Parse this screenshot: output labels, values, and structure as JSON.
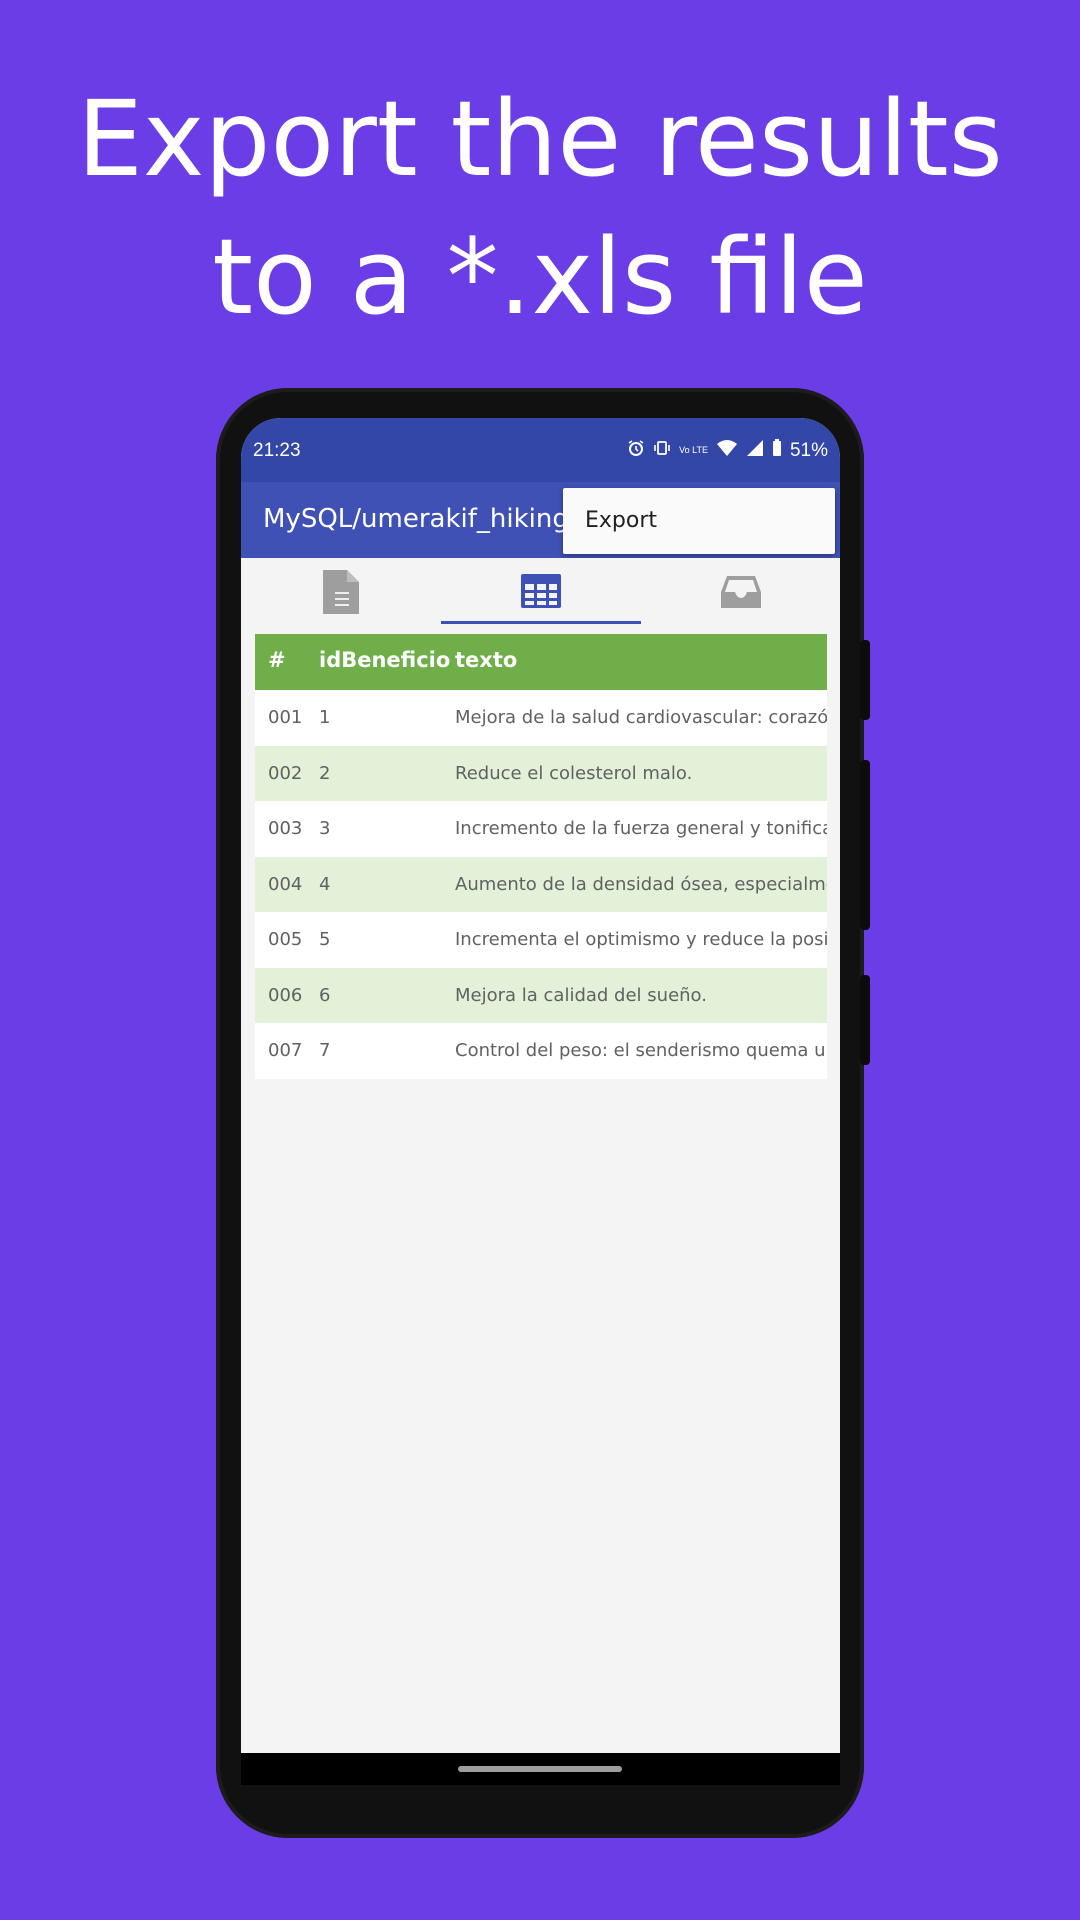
{
  "headline": {
    "line1": "Export the results",
    "line2": "to a *.xls file"
  },
  "status_bar": {
    "time": "21:23",
    "icons": [
      "alarm-icon",
      "vibrate-icon",
      "volte-icon",
      "wifi-icon",
      "signal-icon",
      "battery-icon"
    ],
    "lte_label": "Vo LTE",
    "battery": "51%"
  },
  "app_bar": {
    "title": "MySQL/umerakif_hiking"
  },
  "popup_menu": {
    "items": [
      "Export"
    ]
  },
  "tabs": [
    {
      "icon": "document-icon",
      "selected": false
    },
    {
      "icon": "table-icon",
      "selected": true
    },
    {
      "icon": "inbox-icon",
      "selected": false
    }
  ],
  "table": {
    "columns": [
      "#",
      "idBeneficio",
      "texto"
    ],
    "rows": [
      [
        "001",
        "1",
        "Mejora de la salud cardiovascular: corazón,"
      ],
      [
        "002",
        "2",
        "Reduce el colesterol malo."
      ],
      [
        "003",
        "3",
        "Incremento de la fuerza general y tonificac"
      ],
      [
        "004",
        "4",
        "Aumento de la densidad ósea, especialme"
      ],
      [
        "005",
        "5",
        "Incrementa el optimismo y reduce la posib"
      ],
      [
        "006",
        "6",
        "Mejora la calidad del sueño."
      ],
      [
        "007",
        "7",
        "Control del peso: el senderismo quema un"
      ]
    ]
  },
  "colors": {
    "background": "#6a3de6",
    "status_bar": "#3347a8",
    "app_bar": "#3f51b5",
    "table_header": "#6fae48",
    "row_alt": "#e3f1d9"
  }
}
